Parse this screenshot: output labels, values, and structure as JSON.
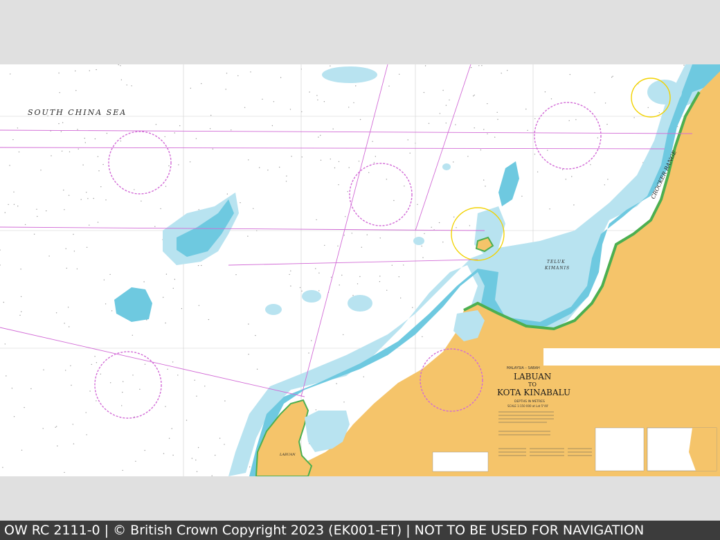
{
  "colors": {
    "land": "#f5c46a",
    "deep_water": "#ffffff",
    "shallow_water": "#b8e3f0",
    "very_shallow": "#6ec9e0",
    "intertidal": "#4caf50",
    "magenta_lines": "#d26ad6",
    "viewer_bg": "#e0e0e0",
    "status_bar": "#3c3c3c"
  },
  "chart": {
    "sea_name": "SOUTH   CHINA   SEA",
    "feature_labels": {
      "telok_kimanis": "TELUK",
      "telok_kimanis_2": "KIMANIS",
      "labuan": "LABUAN",
      "crocker_range": "CROCKER RANGE"
    },
    "title_block": {
      "region": "MALAYSIA – SABAH",
      "line1": "LABUAN",
      "line2": "TO",
      "line3": "KOTA KINABALU",
      "depths": "DEPTHS IN METRES",
      "scale": "SCALE 1:150 000 at Lat 5°40'"
    }
  },
  "status_bar": {
    "text": "OW RC 2111-0 | © British Crown Copyright 2023 (EK001-ET) | NOT TO BE USED FOR NAVIGATION"
  }
}
